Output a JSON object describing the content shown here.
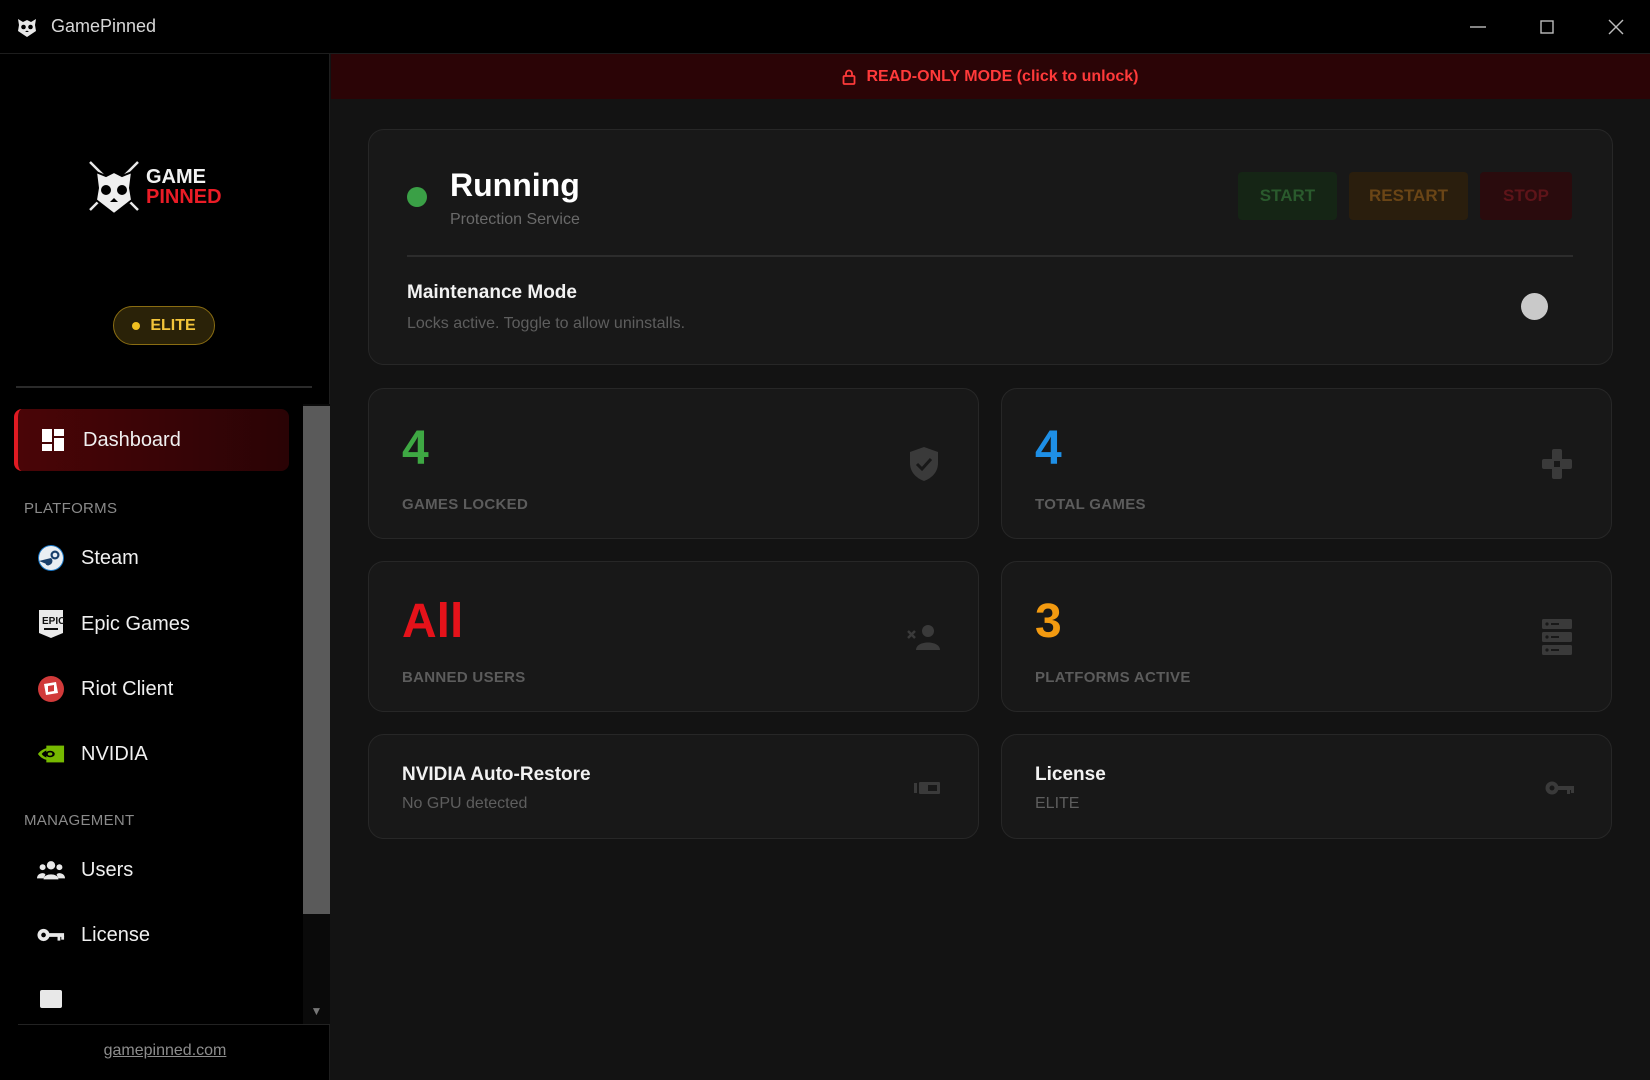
{
  "window": {
    "title": "GamePinned",
    "controls": {
      "minimize": "minimize-icon",
      "maximize": "maximize-icon",
      "close": "close-icon"
    }
  },
  "sidebar": {
    "logo": {
      "line1": "GAME",
      "line2": "PINNED"
    },
    "tier_badge": "ELITE",
    "nav": [
      {
        "label": "Dashboard",
        "icon": "dashboard-icon",
        "active": true
      }
    ],
    "sections": [
      {
        "title": "PLATFORMS",
        "items": [
          {
            "label": "Steam",
            "icon": "steam-icon"
          },
          {
            "label": "Epic Games",
            "icon": "epic-games-icon"
          },
          {
            "label": "Riot Client",
            "icon": "riot-client-icon"
          },
          {
            "label": "NVIDIA",
            "icon": "nvidia-icon"
          }
        ]
      },
      {
        "title": "MANAGEMENT",
        "items": [
          {
            "label": "Users",
            "icon": "users-icon"
          },
          {
            "label": "License",
            "icon": "key-icon"
          }
        ]
      }
    ],
    "footer_link": "gamepinned.com"
  },
  "banner": {
    "text": "READ-ONLY MODE (click to unlock)",
    "icon": "lock-icon"
  },
  "service": {
    "status": "Running",
    "subtitle": "Protection Service",
    "buttons": {
      "start": "START",
      "restart": "RESTART",
      "stop": "STOP"
    },
    "maintenance": {
      "title": "Maintenance Mode",
      "description": "Locks active. Toggle to allow uninstalls.",
      "enabled": false
    }
  },
  "stats": [
    {
      "value": "4",
      "label": "GAMES LOCKED",
      "color": "#3ea843",
      "icon": "shield-check-icon"
    },
    {
      "value": "4",
      "label": "TOTAL GAMES",
      "color": "#1e8fe6",
      "icon": "gamepad-icon"
    },
    {
      "value": "All",
      "label": "BANNED USERS",
      "color": "#e5121a",
      "icon": "user-ban-icon"
    },
    {
      "value": "3",
      "label": "PLATFORMS ACTIVE",
      "color": "#f39a10",
      "icon": "server-icon"
    }
  ],
  "info_cards": [
    {
      "title": "NVIDIA Auto-Restore",
      "subtitle": "No GPU detected",
      "icon": "gpu-icon"
    },
    {
      "title": "License",
      "subtitle": "ELITE",
      "icon": "key-icon"
    }
  ],
  "colors": {
    "accent": "#e01a22",
    "running": "#3aa046",
    "elite": "#f3c53a"
  }
}
